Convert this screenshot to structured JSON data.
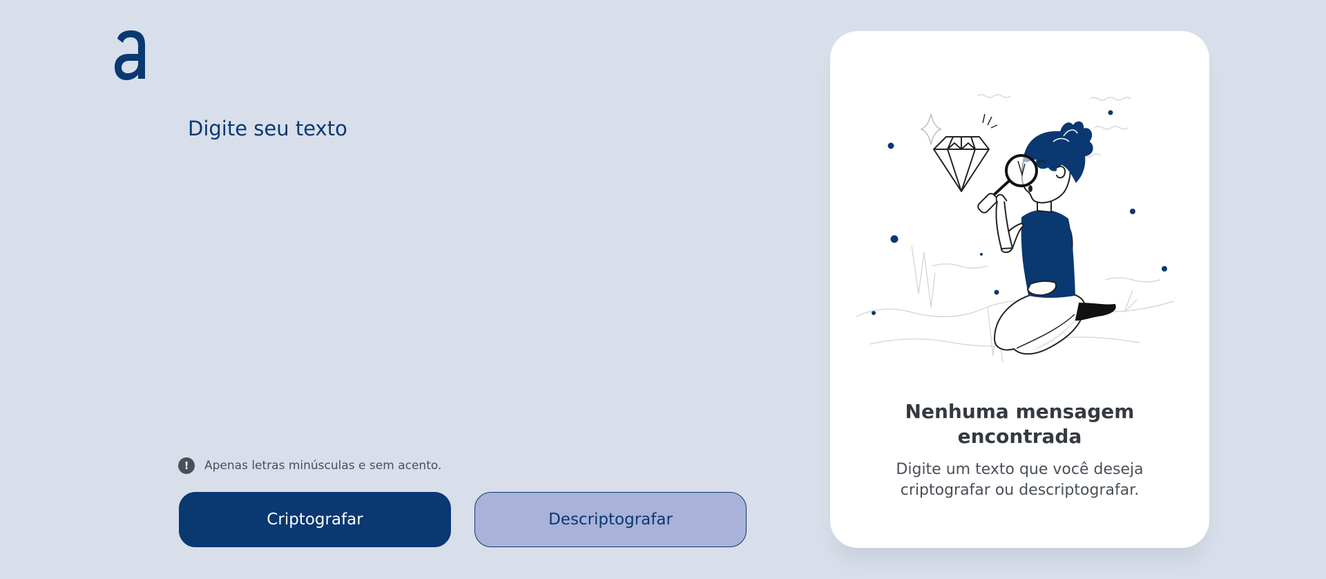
{
  "logo": {
    "icon": "alura-a-logo",
    "color": "#0a3871"
  },
  "input": {
    "placeholder": "Digite seu texto",
    "value": ""
  },
  "hint": {
    "icon": "exclamation-icon",
    "text": "Apenas letras minúsculas e sem acento."
  },
  "buttons": {
    "encrypt_label": "Criptografar",
    "decrypt_label": "Descriptografar"
  },
  "output": {
    "illustration": "person-with-magnifier-and-diamond",
    "title": "Nenhuma mensagem encontrada",
    "description": "Digite um texto que você deseja criptografar ou descriptografar."
  },
  "colors": {
    "background": "#d8dfea",
    "primary": "#0a3871",
    "secondary": "#a9b2d8",
    "card": "#ffffff",
    "text_dark": "#343a40",
    "text_muted": "#495057"
  }
}
